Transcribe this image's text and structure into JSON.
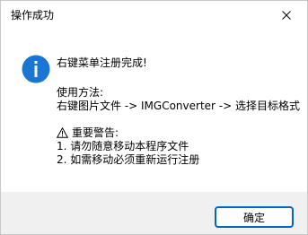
{
  "window": {
    "title": "操作成功",
    "close_icon": "close-icon"
  },
  "message": {
    "icon": "info-icon",
    "line1": "右键菜单注册完成!",
    "usage_heading": "使用方法:",
    "usage_text": "右键图片文件 -> IMGConverter -> 选择目标格式",
    "warning_icon": "warning-triangle-icon",
    "warning_heading": "重要警告:",
    "warning_item1": "1. 请勿随意移动本程序文件",
    "warning_item2": "2. 如需移动必须重新运行注册"
  },
  "buttons": {
    "ok_label": "确定"
  },
  "colors": {
    "accent": "#0067c0",
    "info_icon": "#1976d2"
  }
}
